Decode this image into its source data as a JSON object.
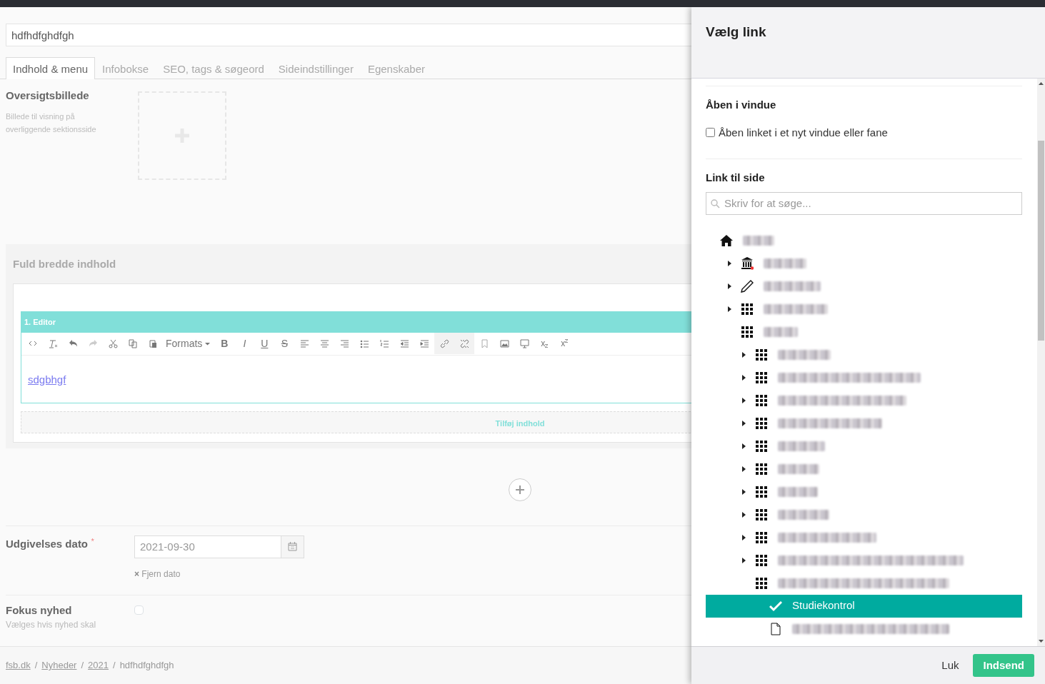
{
  "title_field": {
    "value": "hdfhdfghdfgh"
  },
  "tabs": [
    {
      "label": "Indhold & menu",
      "selected": true
    },
    {
      "label": "Infobokse",
      "selected": false
    },
    {
      "label": "SEO, tags & søgeord",
      "selected": false
    },
    {
      "label": "Sideindstillinger",
      "selected": false
    },
    {
      "label": "Egenskaber",
      "selected": false
    }
  ],
  "overview_image": {
    "label": "Oversigtsbillede",
    "help": "Billede til visning på overliggende sektionsside"
  },
  "full_width": {
    "heading": "Fuld bredde indhold",
    "editor_title": "1. Editor",
    "toolbar": [
      {
        "kind": "code"
      },
      {
        "kind": "clear"
      },
      {
        "kind": "undo"
      },
      {
        "kind": "redo",
        "disabled": true
      },
      {
        "kind": "cut"
      },
      {
        "kind": "copy"
      },
      {
        "kind": "paste"
      },
      {
        "kind": "dropdown",
        "label": "Formats"
      },
      {
        "kind": "bold",
        "label": "B"
      },
      {
        "kind": "italic",
        "label": "I"
      },
      {
        "kind": "underline",
        "label": "U"
      },
      {
        "kind": "strike",
        "label": "S"
      },
      {
        "kind": "align-left"
      },
      {
        "kind": "align-center"
      },
      {
        "kind": "align-right"
      },
      {
        "kind": "bullets"
      },
      {
        "kind": "numbers"
      },
      {
        "kind": "outdent"
      },
      {
        "kind": "indent"
      },
      {
        "kind": "link",
        "active": true
      },
      {
        "kind": "unlink",
        "active": true
      },
      {
        "kind": "bookmark"
      },
      {
        "kind": "image"
      },
      {
        "kind": "monitor"
      },
      {
        "kind": "subscript",
        "label": "x"
      },
      {
        "kind": "superscript",
        "label": "x"
      }
    ],
    "content_link": "sdgbhgf",
    "add_content": "Tilføj indhold"
  },
  "publish_date": {
    "label": "Udgivelses dato",
    "required": "*",
    "value": "2021-09-30",
    "remove_icon": "×",
    "remove": "Fjern dato"
  },
  "focus_news": {
    "label": "Fokus nyhed",
    "checked": false,
    "help": "Vælges hvis nyhed skal"
  },
  "breadcrumb": [
    {
      "label": "fsb.dk",
      "link": true
    },
    {
      "separator": "/",
      "label": "Nyheder",
      "link": true
    },
    {
      "separator": "/",
      "label": "2021",
      "link": true
    },
    {
      "separator": "/",
      "label": "hdfhdfghdfgh",
      "link": false
    }
  ],
  "dialog": {
    "title": "Vælg link",
    "open_in_window": {
      "heading": "Åben i vindue",
      "label": "Åben linket i et nyt vindue eller fane",
      "checked": false
    },
    "link_to_page": {
      "heading": "Link til side",
      "placeholder": "Skriv for at søge..."
    },
    "tree": [
      {
        "kind": "home",
        "expandable": false,
        "redacted": true,
        "selected": false,
        "children": [
          {
            "kind": "bank",
            "expandable": true,
            "redacted": true,
            "selected": false
          },
          {
            "kind": "pencil",
            "expandable": true,
            "redacted": true,
            "selected": false
          },
          {
            "kind": "grid",
            "expandable": true,
            "redacted": true,
            "selected": false
          },
          {
            "kind": "grid",
            "expandable": false,
            "redacted": true,
            "selected": false,
            "children": [
              {
                "kind": "grid",
                "expandable": true,
                "redacted": true,
                "selected": false
              },
              {
                "kind": "grid",
                "expandable": true,
                "redacted": true,
                "selected": false
              },
              {
                "kind": "grid",
                "expandable": true,
                "redacted": true,
                "selected": false
              },
              {
                "kind": "grid",
                "expandable": true,
                "redacted": true,
                "selected": false
              },
              {
                "kind": "grid",
                "expandable": true,
                "redacted": true,
                "selected": false
              },
              {
                "kind": "grid",
                "expandable": true,
                "redacted": true,
                "selected": false
              },
              {
                "kind": "grid",
                "expandable": true,
                "redacted": true,
                "selected": false
              },
              {
                "kind": "grid",
                "expandable": true,
                "redacted": true,
                "selected": false
              },
              {
                "kind": "grid",
                "expandable": true,
                "redacted": true,
                "selected": false
              },
              {
                "kind": "grid",
                "expandable": true,
                "redacted": true,
                "selected": false
              },
              {
                "kind": "grid",
                "expandable": false,
                "redacted": true,
                "selected": false,
                "children": [
                  {
                    "kind": "check",
                    "expandable": false,
                    "redacted": false,
                    "selected": true,
                    "label": "Studiekontrol"
                  },
                  {
                    "kind": "file",
                    "expandable": false,
                    "redacted": true,
                    "selected": false
                  }
                ]
              }
            ]
          }
        ]
      }
    ],
    "buttons": [
      {
        "label": "Luk",
        "kind": "link"
      },
      {
        "label": "Indsend",
        "kind": "primary"
      }
    ]
  }
}
